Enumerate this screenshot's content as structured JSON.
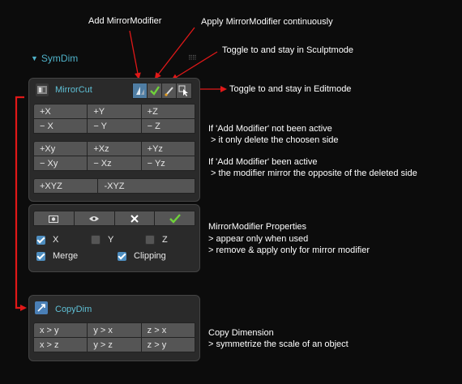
{
  "annotations": {
    "add_modifier": "Add MirrorModifier",
    "apply_modifier": "Apply MirrorModifier continuously",
    "sculpt_toggle": "Toggle to and stay in Sculptmode",
    "edit_toggle": "Toggle to and stay in Editmode",
    "not_active_1": "If 'Add Modifier' not been active",
    "not_active_2": " > it only delete the choosen side",
    "active_1": "If 'Add Modifier' been active",
    "active_2": " > the modifier mirror the opposite of the deleted side",
    "props_1": "MirrorModifier Properties",
    "props_2": "> appear only when used",
    "props_3": "> remove & apply only for mirror modifier",
    "copy_1": "Copy Dimension",
    "copy_2": "> symmetrize the scale of an object"
  },
  "symdim": {
    "label": "SymDim"
  },
  "mirrorcut": {
    "title": "MirrorCut",
    "row_pos": [
      "+X",
      "+Y",
      "+Z"
    ],
    "row_neg": [
      "− X",
      "− Y",
      "− Z"
    ],
    "row_pos2": [
      "+Xy",
      "+Xz",
      "+Yz"
    ],
    "row_neg2": [
      "− Xy",
      "− Xz",
      "− Yz"
    ],
    "row_xyz": [
      "+XYZ",
      "-XYZ"
    ]
  },
  "modifier_props": {
    "toolbar_icons": [
      "camera-icon",
      "eye-icon",
      "close-icon",
      "check-icon"
    ],
    "x_label": "X",
    "x_checked": true,
    "y_label": "Y",
    "y_checked": false,
    "z_label": "Z",
    "z_checked": false,
    "merge_label": "Merge",
    "merge_checked": true,
    "clipping_label": "Clipping",
    "clipping_checked": true
  },
  "copydim": {
    "title": "CopyDim",
    "row1": [
      "x > y",
      "y > x",
      "z > x"
    ],
    "row2": [
      "x > z",
      "y > z",
      "z > y"
    ]
  },
  "colors": {
    "accent": "#4fb2c9",
    "arrow": "#e01818",
    "check": "#6fd23a"
  }
}
